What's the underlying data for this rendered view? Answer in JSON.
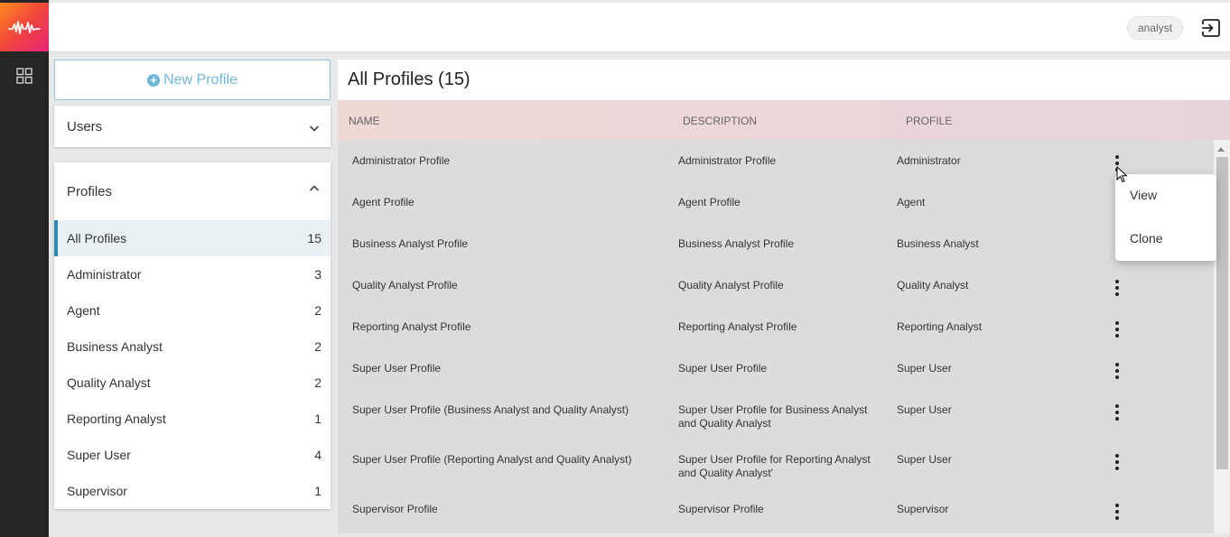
{
  "header": {
    "username": "analyst"
  },
  "left_panel": {
    "new_profile_label": "New Profile",
    "users_label": "Users",
    "profiles_label": "Profiles",
    "profile_filters": [
      {
        "label": "All Profiles",
        "count": "15",
        "active": true
      },
      {
        "label": "Administrator",
        "count": "3"
      },
      {
        "label": "Agent",
        "count": "2"
      },
      {
        "label": "Business Analyst",
        "count": "2"
      },
      {
        "label": "Quality Analyst",
        "count": "2"
      },
      {
        "label": "Reporting Analyst",
        "count": "1"
      },
      {
        "label": "Super User",
        "count": "4"
      },
      {
        "label": "Supervisor",
        "count": "1"
      }
    ]
  },
  "main": {
    "title": "All Profiles (15)",
    "columns": [
      "NAME",
      "DESCRIPTION",
      "PROFILE"
    ],
    "rows": [
      {
        "name": "Administrator Profile",
        "description": "Administrator Profile",
        "profile": "Administrator"
      },
      {
        "name": "Agent Profile",
        "description": "Agent Profile",
        "profile": "Agent"
      },
      {
        "name": "Business Analyst Profile",
        "description": "Business Analyst Profile",
        "profile": "Business Analyst"
      },
      {
        "name": "Quality Analyst Profile",
        "description": "Quality Analyst Profile",
        "profile": "Quality Analyst"
      },
      {
        "name": "Reporting Analyst Profile",
        "description": "Reporting Analyst Profile",
        "profile": "Reporting Analyst"
      },
      {
        "name": "Super User Profile",
        "description": "Super User Profile",
        "profile": "Super User"
      },
      {
        "name": "Super User Profile (Business Analyst and Quality Analyst)",
        "description": "Super User Profile for Business Analyst and Quality Analyst",
        "profile": "Super User"
      },
      {
        "name": "Super User Profile (Reporting Analyst and Quality Analyst)",
        "description": "Super User Profile for Reporting Analyst and Quality Analyst'",
        "profile": "Super User"
      },
      {
        "name": "Supervisor Profile",
        "description": "Supervisor Profile",
        "profile": "Supervisor"
      }
    ]
  },
  "context_menu": {
    "items": [
      "View",
      "Clone"
    ]
  }
}
